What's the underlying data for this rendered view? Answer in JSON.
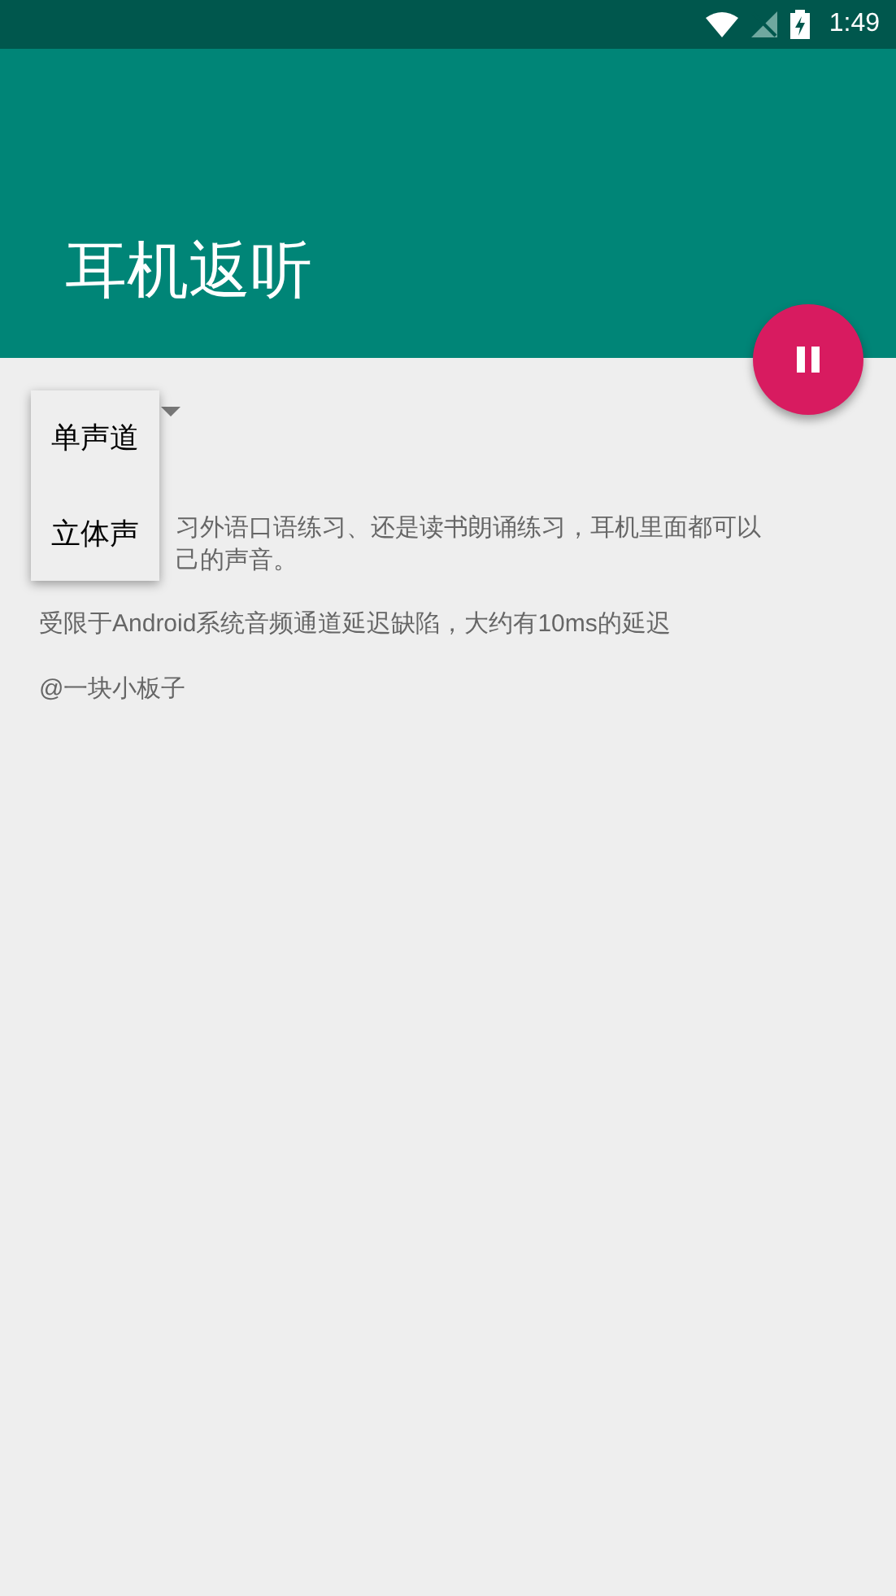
{
  "status_bar": {
    "time": "1:49"
  },
  "app_bar": {
    "title": "耳机返听"
  },
  "dropdown_menu": {
    "items": [
      {
        "label": "单声道"
      },
      {
        "label": "立体声"
      }
    ]
  },
  "description_lines": [
    "习外语口语练习、还是读书朗诵练习，耳机里面都可以",
    "己的声音。"
  ],
  "notes": [
    "受限于Android系统音频通道延迟缺陷，大约有10ms的延迟",
    "@一块小板子"
  ]
}
